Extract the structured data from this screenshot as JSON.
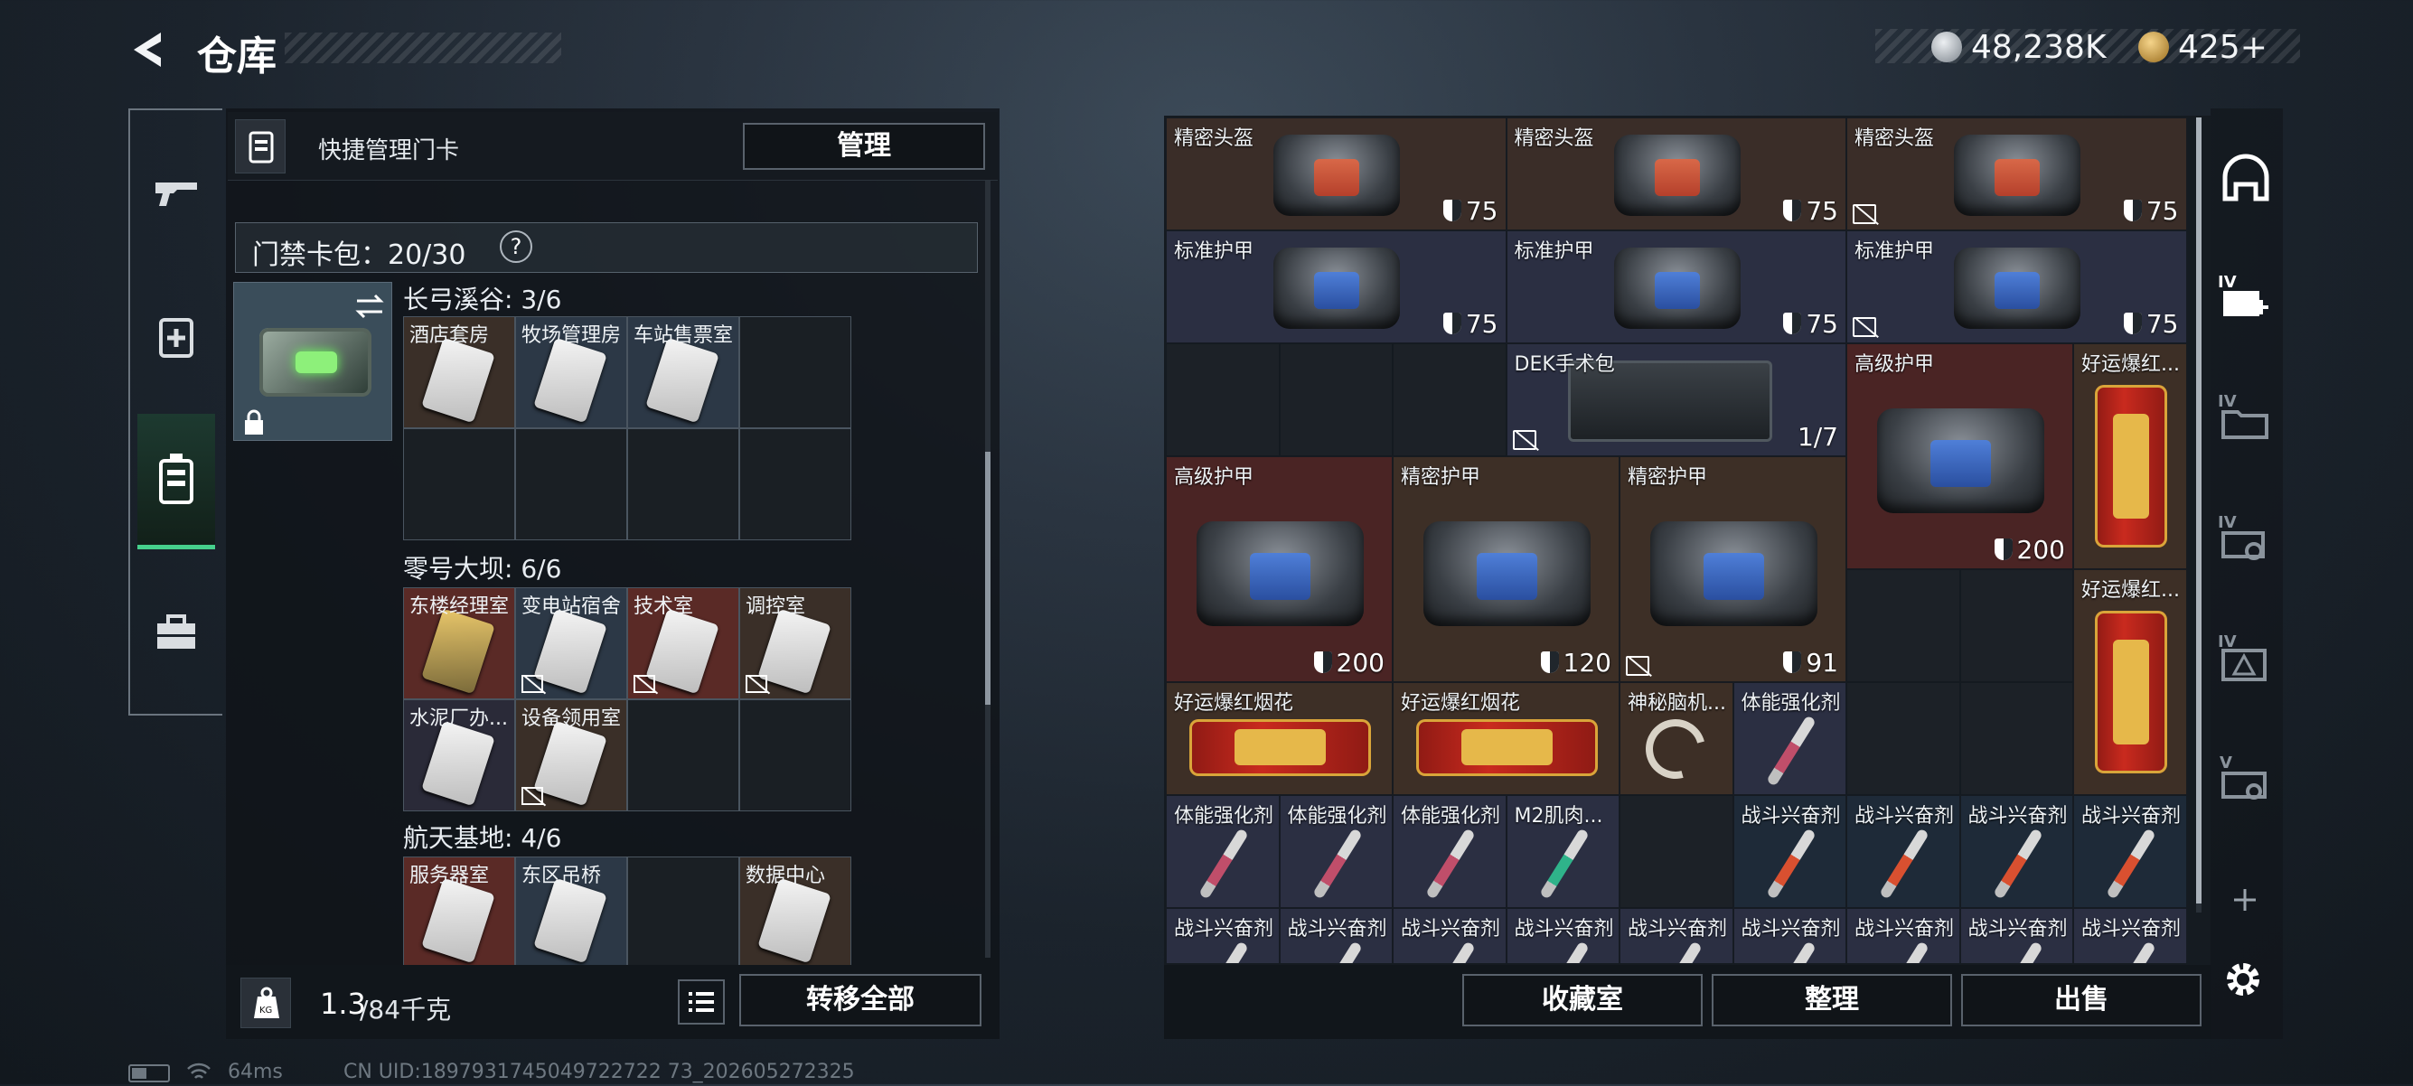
{
  "header": {
    "title": "仓库",
    "currency": [
      {
        "icon": "silver-coin-icon",
        "value": "48,238K"
      },
      {
        "icon": "gold-coin-icon",
        "value": "425+"
      }
    ]
  },
  "left_tabs": [
    "gun-icon",
    "medkit-icon",
    "keycard-icon",
    "toolbox-icon"
  ],
  "quick_manage": {
    "label": "快捷管理门卡",
    "button": "管理"
  },
  "card_pack": {
    "label": "门禁卡包：20/30",
    "help": "?"
  },
  "groups": [
    {
      "title": "长弓溪谷: 3/6",
      "cards": [
        "酒店套房",
        "牧场管理房",
        "车站售票室"
      ]
    },
    {
      "title": "零号大坝: 6/6",
      "cards": [
        "东楼经理室",
        "变电站宿舍",
        "技术室",
        "调控室",
        "水泥厂办...",
        "设备领用室"
      ]
    },
    {
      "title": "航天基地: 4/6",
      "cards": [
        "服务器室",
        "东区吊桥",
        "",
        "数据中心"
      ]
    }
  ],
  "bottom_left": {
    "weight": "1.3",
    "weight_max": "/84千克",
    "transfer_all": "转移全部"
  },
  "items": [
    {
      "name": "精密头盔",
      "val": "75"
    },
    {
      "name": "精密头盔",
      "val": "75"
    },
    {
      "name": "精密头盔",
      "val": "75"
    },
    {
      "name": "标准护甲",
      "val": "75"
    },
    {
      "name": "标准护甲",
      "val": "75"
    },
    {
      "name": "标准护甲",
      "val": "75"
    },
    {
      "name": "DEK手术包",
      "val": "1/7"
    },
    {
      "name": "高级护甲",
      "val": "200"
    },
    {
      "name": "好运爆红..."
    },
    {
      "name": "高级护甲",
      "val": "200"
    },
    {
      "name": "精密护甲",
      "val": "120"
    },
    {
      "name": "精密护甲",
      "val": "91"
    },
    {
      "name": "好运爆红..."
    },
    {
      "name": "好运爆红烟花"
    },
    {
      "name": "好运爆红烟花"
    },
    {
      "name": "神秘脑机..."
    },
    {
      "name": "体能强化剂"
    },
    {
      "name": "体能强化剂"
    },
    {
      "name": "体能强化剂"
    },
    {
      "name": "体能强化剂"
    },
    {
      "name": "M2肌肉..."
    },
    {
      "name": "战斗兴奋剂"
    },
    {
      "name": "战斗兴奋剂"
    },
    {
      "name": "战斗兴奋剂"
    },
    {
      "name": "战斗兴奋剂"
    },
    {
      "name": "战斗兴奋剂"
    },
    {
      "name": "战斗兴奋剂"
    },
    {
      "name": "战斗兴奋剂"
    },
    {
      "name": "战斗兴奋剂"
    },
    {
      "name": "战斗兴奋剂"
    },
    {
      "name": "战斗兴奋剂"
    },
    {
      "name": "战斗兴奋剂"
    },
    {
      "name": "战斗兴奋剂"
    },
    {
      "name": "战斗兴奋剂"
    }
  ],
  "bottom_right": {
    "collection": "收藏室",
    "sort": "整理",
    "sell": "出售"
  },
  "right_tabs": [
    "helmet-icon",
    "IV",
    "IV",
    "IV",
    "IV",
    "V"
  ],
  "status": {
    "ping": "64ms",
    "uid": "CN UID:1897931745049722722 73_202605272325"
  }
}
